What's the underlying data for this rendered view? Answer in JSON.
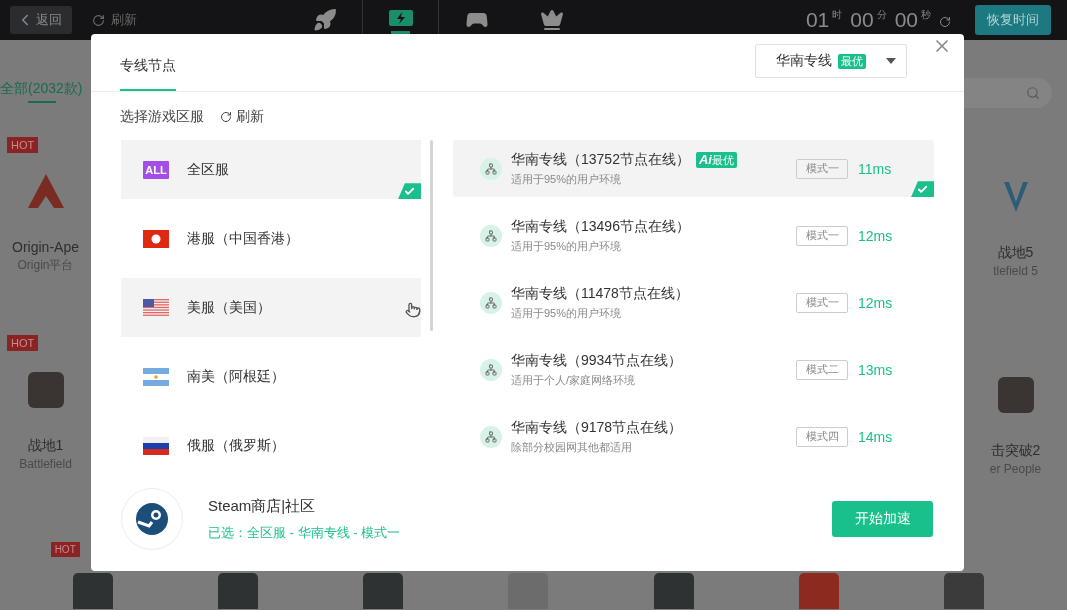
{
  "topbar": {
    "back": "返回",
    "refresh": "刷新",
    "nav": [
      {
        "kind": "rocket",
        "selected": false
      },
      {
        "kind": "monitor",
        "selected": true
      },
      {
        "kind": "gamepad",
        "selected": false
      },
      {
        "kind": "crown",
        "selected": false
      }
    ],
    "timer": [
      {
        "value": "01",
        "unit": "时"
      },
      {
        "value": "00",
        "unit": "分"
      },
      {
        "value": "00",
        "unit": "秒"
      }
    ],
    "restore": "恢复时间"
  },
  "category_tab": {
    "label": "全部(2032款)",
    "selected": true
  },
  "left_games": [
    {
      "badge": "HOT",
      "kind": "apex",
      "title": "Origin-Ape",
      "subtitle": "Origin平台"
    },
    {
      "badge": "HOT",
      "kind": "photo",
      "title": "战地1",
      "subtitle": "Battlefield"
    }
  ],
  "right_games": [
    {
      "kind": "v",
      "title": "战地5",
      "subtitle": "tlefield 5"
    },
    {
      "kind": "photo",
      "title": "击突破2",
      "subtitle": "er People"
    }
  ],
  "bottom_games": [
    {
      "badge": "HOT",
      "kind": "photo"
    },
    {
      "kind": "photo"
    },
    {
      "kind": "photo"
    },
    {
      "kind": "pubg"
    },
    {
      "kind": "photo"
    },
    {
      "kind": "apex"
    },
    {
      "kind": "epic"
    }
  ],
  "dialog": {
    "tab": {
      "label": "专线节点",
      "selected": true
    },
    "line_select": {
      "value": "华南专线",
      "badge": "最优"
    },
    "region_heading": "选择游戏区服",
    "refresh": "刷新",
    "regions": [
      {
        "kind": "all",
        "flag_label": "ALL",
        "label": "全区服",
        "selected": true,
        "hovered": false
      },
      {
        "kind": "hk",
        "label": "港服（中国香港）",
        "selected": false,
        "hovered": false
      },
      {
        "kind": "us",
        "label": "美服（美国）",
        "selected": false,
        "hovered": true
      },
      {
        "kind": "ar",
        "label": "南美（阿根廷）",
        "selected": false,
        "hovered": false
      },
      {
        "kind": "ru",
        "label": "俄服（俄罗斯）",
        "selected": false,
        "hovered": false
      }
    ],
    "nodes": [
      {
        "name": "华南专线（13752节点在线）",
        "badge": "**Ai**最优",
        "description": "适用于95%的用户环境",
        "mode": "模式一",
        "latency": "11ms",
        "selected": true
      },
      {
        "name": "华南专线（13496节点在线）",
        "description": "适用于95%的用户环境",
        "mode": "模式一",
        "latency": "12ms",
        "selected": false
      },
      {
        "name": "华南专线（11478节点在线）",
        "description": "适用于95%的用户环境",
        "mode": "模式一",
        "latency": "12ms",
        "selected": false
      },
      {
        "name": "华南专线（9934节点在线）",
        "description": "适用于个人/家庭网络环境",
        "mode": "模式二",
        "latency": "13ms",
        "selected": false
      },
      {
        "name": "华南专线（9178节点在线）",
        "description": "除部分校园网其他都适用",
        "mode": "模式四",
        "latency": "14ms",
        "selected": false
      }
    ],
    "app_name": "Steam商店|社区",
    "selection": "已选：全区服 - 华南专线 - 模式一",
    "start_button": "开始加速"
  }
}
